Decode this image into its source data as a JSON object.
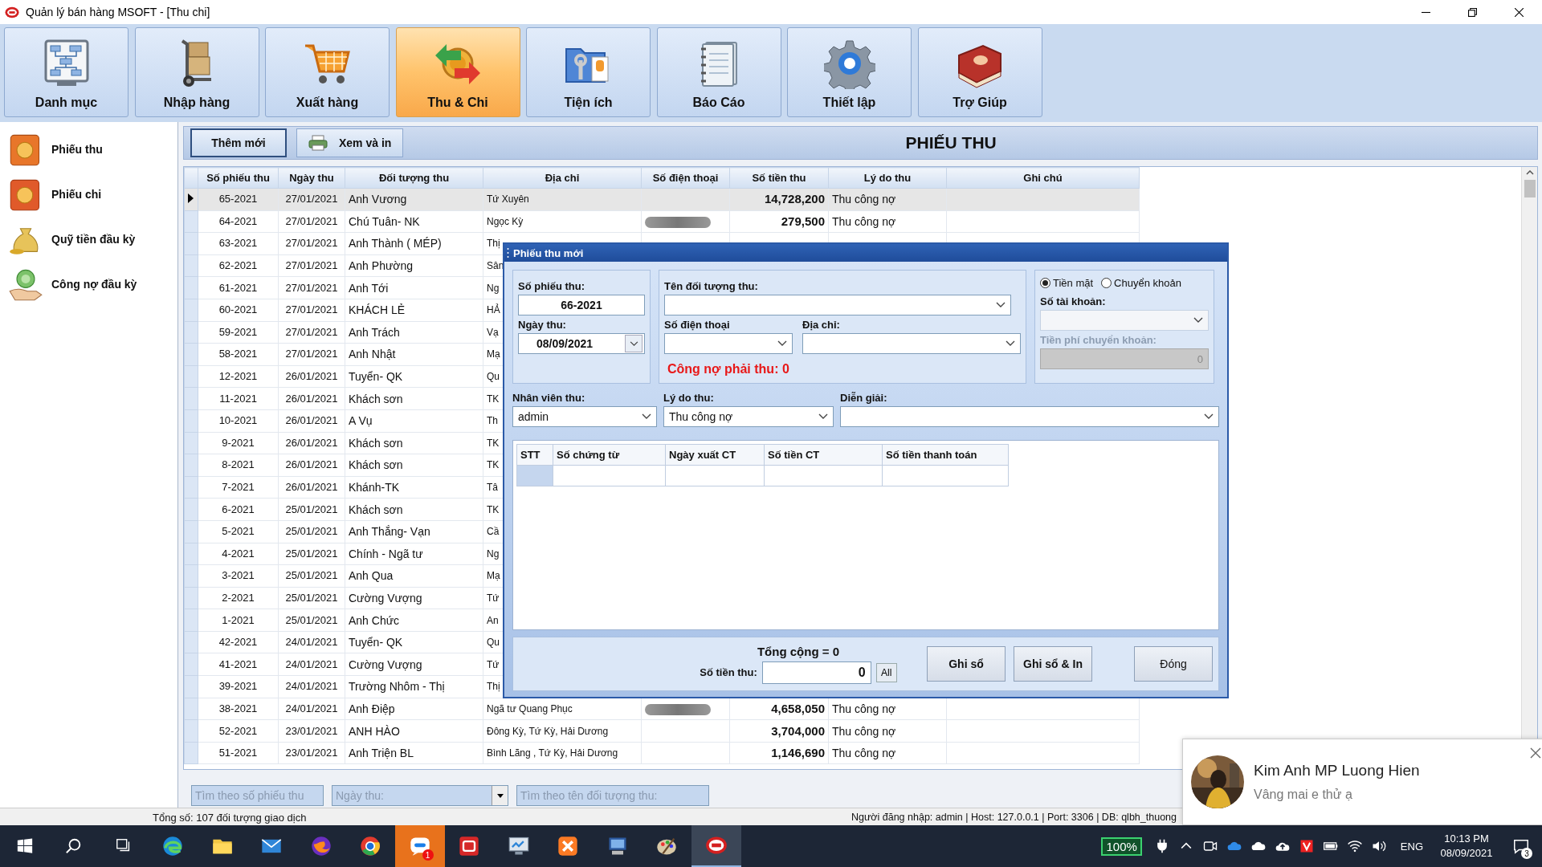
{
  "window": {
    "title": "Quản lý bán hàng MSOFT - [Thu chi]"
  },
  "toolbar": [
    {
      "label": "Danh mục",
      "selected": false
    },
    {
      "label": "Nhập hàng",
      "selected": false
    },
    {
      "label": "Xuất hàng",
      "selected": false
    },
    {
      "label": "Thu & Chi",
      "selected": true
    },
    {
      "label": "Tiện ích",
      "selected": false
    },
    {
      "label": "Báo Cáo",
      "selected": false
    },
    {
      "label": "Thiết lập",
      "selected": false
    },
    {
      "label": "Trợ Giúp",
      "selected": false
    }
  ],
  "sidebar": {
    "items": [
      {
        "label": "Phiếu thu"
      },
      {
        "label": "Phiếu chi"
      },
      {
        "label": "Quỹ tiền đầu kỳ"
      },
      {
        "label": "Công nợ đầu kỳ"
      }
    ]
  },
  "actions": [
    {
      "label": "Thêm mới",
      "focused": true
    },
    {
      "label": "Xem và in",
      "focused": false
    }
  ],
  "page_title": "PHIẾU THU",
  "table": {
    "columns": [
      "Số phiếu thu",
      "Ngày thu",
      "Đối tượng thu",
      "Địa chỉ",
      "Số điện thoại",
      "Số tiền thu",
      "Lý do thu",
      "Ghi chú"
    ],
    "rows": [
      {
        "no": "65-2021",
        "date": "27/01/2021",
        "party": "Anh Vương",
        "address": "Tứ Xuyên",
        "phone_hidden": false,
        "amount": "14,728,200",
        "reason": "Thu công nợ",
        "selected": true
      },
      {
        "no": "64-2021",
        "date": "27/01/2021",
        "party": "Chú Tuân- NK",
        "address": "Ngọc Kỳ",
        "phone_hidden": true,
        "amount": "279,500",
        "reason": "Thu công nợ",
        "selected": false
      },
      {
        "no": "63-2021",
        "date": "27/01/2021",
        "party": "Anh Thành ( MÉP)",
        "address": "Thị",
        "selected": false
      },
      {
        "no": "62-2021",
        "date": "27/01/2021",
        "party": "Anh Phường",
        "address": "Sân",
        "selected": false
      },
      {
        "no": "61-2021",
        "date": "27/01/2021",
        "party": "Anh Tới",
        "address": "Ng",
        "selected": false
      },
      {
        "no": "60-2021",
        "date": "27/01/2021",
        "party": "KHÁCH LẺ",
        "address": "HẢ",
        "selected": false
      },
      {
        "no": "59-2021",
        "date": "27/01/2021",
        "party": "Anh Trách",
        "address": "Vạ",
        "selected": false
      },
      {
        "no": "58-2021",
        "date": "27/01/2021",
        "party": "Anh Nhật",
        "address": "Mạ",
        "selected": false
      },
      {
        "no": "12-2021",
        "date": "26/01/2021",
        "party": "Tuyển-  QK",
        "address": "Qu",
        "selected": false
      },
      {
        "no": "11-2021",
        "date": "26/01/2021",
        "party": "Khách sơn",
        "address": "TK",
        "selected": false
      },
      {
        "no": "10-2021",
        "date": "26/01/2021",
        "party": "A Vụ",
        "address": "Th",
        "selected": false
      },
      {
        "no": "9-2021",
        "date": "26/01/2021",
        "party": "Khách sơn",
        "address": "TK",
        "selected": false
      },
      {
        "no": "8-2021",
        "date": "26/01/2021",
        "party": "Khách sơn",
        "address": "TK",
        "selected": false
      },
      {
        "no": "7-2021",
        "date": "26/01/2021",
        "party": "Khánh-TK",
        "address": "Tâ",
        "selected": false
      },
      {
        "no": "6-2021",
        "date": "25/01/2021",
        "party": "Khách sơn",
        "address": "TK",
        "selected": false
      },
      {
        "no": "5-2021",
        "date": "25/01/2021",
        "party": "Anh Thắng- Vạn",
        "address": "Cầ",
        "selected": false
      },
      {
        "no": "4-2021",
        "date": "25/01/2021",
        "party": "Chính - Ngã tư",
        "address": "Ng",
        "selected": false
      },
      {
        "no": "3-2021",
        "date": "25/01/2021",
        "party": "Anh Qua",
        "address": "Mạ",
        "selected": false
      },
      {
        "no": "2-2021",
        "date": "25/01/2021",
        "party": "Cường Vượng",
        "address": "Tứ",
        "selected": false
      },
      {
        "no": "1-2021",
        "date": "25/01/2021",
        "party": "Anh Chức",
        "address": "An",
        "selected": false
      },
      {
        "no": "42-2021",
        "date": "24/01/2021",
        "party": "Tuyển-  QK",
        "address": "Qu",
        "selected": false
      },
      {
        "no": "41-2021",
        "date": "24/01/2021",
        "party": "Cường Vượng",
        "address": "Tứ",
        "selected": false
      },
      {
        "no": "39-2021",
        "date": "24/01/2021",
        "party": "Trường Nhôm - Thị",
        "address": "Thị",
        "selected": false
      },
      {
        "no": "38-2021",
        "date": "24/01/2021",
        "party": "Anh Điệp",
        "address": "Ngã tư Quang Phục",
        "phone_hidden": true,
        "amount": "4,658,050",
        "reason": "Thu công nợ",
        "selected": false
      },
      {
        "no": "52-2021",
        "date": "23/01/2021",
        "party": "ANH HÀO",
        "address": "Đông Kỳ, Tứ Kỳ, Hải Dương",
        "phone_hidden": false,
        "amount": "3,704,000",
        "reason": "Thu công nợ",
        "selected": false
      },
      {
        "no": "51-2021",
        "date": "23/01/2021",
        "party": "Anh Triện BL",
        "address": "Bình Lãng , Tứ Kỳ, Hải Dương",
        "phone_hidden": false,
        "amount": "1,146,690",
        "reason": "Thu công nợ",
        "selected": false
      }
    ]
  },
  "search": [
    {
      "kind": "text",
      "placeholder": "Tìm theo số phiếu thu"
    },
    {
      "kind": "date",
      "placeholder": "Ngày thu:"
    },
    {
      "kind": "text",
      "placeholder": "Tìm theo tên đối tượng thu:"
    }
  ],
  "status_bar": {
    "left": "Tổng số: 107 đối tượng giao dịch",
    "right": "Người đăng nhập: admin | Host: 127.0.0.1 | Port: 3306 | DB: qlbh_thuong"
  },
  "dialog": {
    "title": "Phiếu thu mới",
    "receipt_no": {
      "label": "Số phiếu thu:",
      "value": "66-2021"
    },
    "date": {
      "label": "Ngày thu:",
      "value": "08/09/2021"
    },
    "party": {
      "label": "Tên đối tượng thu:"
    },
    "phone": {
      "label": "Số điện thoại"
    },
    "address": {
      "label": "Địa chỉ:"
    },
    "debt": "Công nợ phải thu: 0",
    "payment": [
      {
        "label": "Tiền mặt",
        "selected": true
      },
      {
        "label": "Chuyển khoản",
        "selected": false
      }
    ],
    "account": {
      "label": "Số tài khoản:",
      "disabled": true
    },
    "fee": {
      "label": "Tiền phí chuyển khoản:",
      "value": "0",
      "disabled": true
    },
    "staff": {
      "label": "Nhân viên thu:",
      "value": "admin"
    },
    "reason": {
      "label": "Lý do thu:",
      "value": "Thu công nợ"
    },
    "note": {
      "label": "Diễn giải:"
    },
    "columns": [
      "STT",
      "Số chứng từ",
      "Ngày xuất CT",
      "Số tiền CT",
      "Số tiền thanh toán"
    ],
    "total": "Tổng cộng = 0",
    "amount": {
      "label": "Số tiền thu:",
      "value": "0"
    },
    "all_button": "All",
    "buttons": [
      "Ghi sổ",
      "Ghi sổ & In",
      "Đóng"
    ]
  },
  "notification": {
    "sender": "Kim Anh MP Luong Hien",
    "message": "Vâng mai e thử ạ"
  },
  "taskbar": {
    "apps": [
      {
        "flashing": false,
        "active": false
      },
      {
        "flashing": false,
        "active": false
      },
      {
        "flashing": false,
        "active": false
      },
      {
        "flashing": false,
        "active": false
      },
      {
        "flashing": false,
        "active": false
      },
      {
        "flashing": true,
        "active": false,
        "badge": "1"
      },
      {
        "flashing": false,
        "active": false
      },
      {
        "flashing": false,
        "active": false
      },
      {
        "flashing": false,
        "active": false
      },
      {
        "flashing": false,
        "active": false
      },
      {
        "flashing": false,
        "active": false
      },
      {
        "flashing": false,
        "active": true
      }
    ],
    "tray": {
      "battery": "100%",
      "language": "ENG",
      "time": "10:13 PM",
      "date": "08/09/2021",
      "notifications": "3"
    }
  }
}
